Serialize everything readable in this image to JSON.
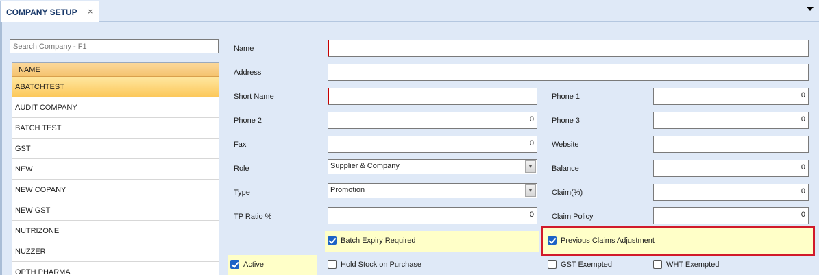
{
  "tab": {
    "title": "COMPANY SETUP",
    "close": "×"
  },
  "search": {
    "placeholder": "Search Company - F1"
  },
  "grid": {
    "header": "NAME",
    "rows": [
      "ABATCHTEST",
      "AUDIT COMPANY",
      "BATCH TEST",
      "GST",
      "NEW",
      "NEW COPANY",
      "NEW GST",
      "NUTRIZONE",
      "NUZZER",
      "OPTH PHARMA"
    ]
  },
  "form": {
    "name_label": "Name",
    "address_label": "Address",
    "short_name_label": "Short Name",
    "phone1_label": "Phone 1",
    "phone1_value": "0",
    "phone2_label": "Phone 2",
    "phone2_value": "0",
    "phone3_label": "Phone 3",
    "phone3_value": "0",
    "fax_label": "Fax",
    "fax_value": "0",
    "website_label": "Website",
    "role_label": "Role",
    "role_value": "Supplier & Company",
    "balance_label": "Balance",
    "balance_value": "0",
    "type_label": "Type",
    "type_value": "Promotion",
    "claim_label": "Claim(%)",
    "claim_value": "0",
    "tp_ratio_label": "TP Ratio %",
    "tp_ratio_value": "0",
    "claim_policy_label": "Claim Policy",
    "claim_policy_value": "0"
  },
  "checks": {
    "batch_expiry": "Batch Expiry Required",
    "previous_claims": "Previous Claims Adjustment",
    "active": "Active",
    "hold_stock": "Hold Stock on Purchase",
    "gst_exempted": "GST Exempted",
    "wht_exempted": "WHT Exempted"
  }
}
